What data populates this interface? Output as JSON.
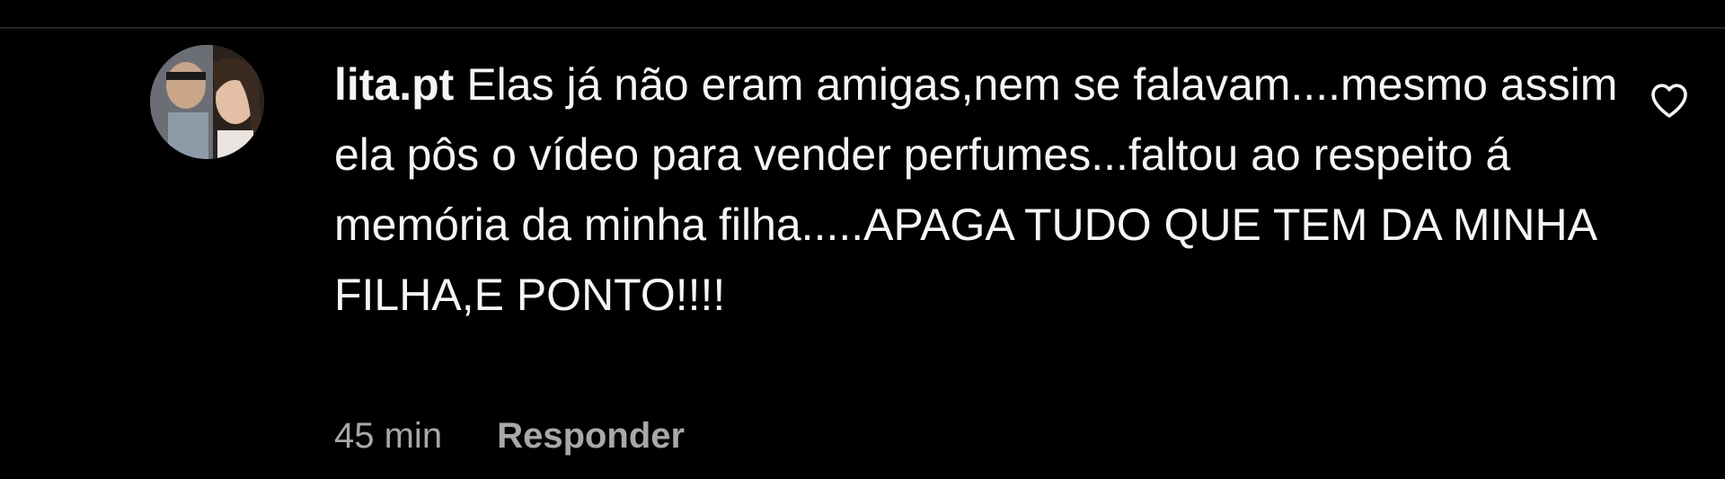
{
  "comment": {
    "username": "lita.pt",
    "text": "Elas já não eram amigas,nem se falavam....mesmo assim ela pôs o vídeo para vender perfumes...faltou ao respeito á memória da minha filha.....APAGA TUDO QUE TEM DA MINHA FILHA,E PONTO!!!!",
    "timestamp": "45 min",
    "reply_label": "Responder",
    "like_icon": "heart-outline-icon",
    "avatar_icon": "profile-photo"
  },
  "colors": {
    "background": "#000000",
    "text_primary": "#f5f5f5",
    "text_secondary": "#a8a8a8",
    "divider": "#262626"
  }
}
